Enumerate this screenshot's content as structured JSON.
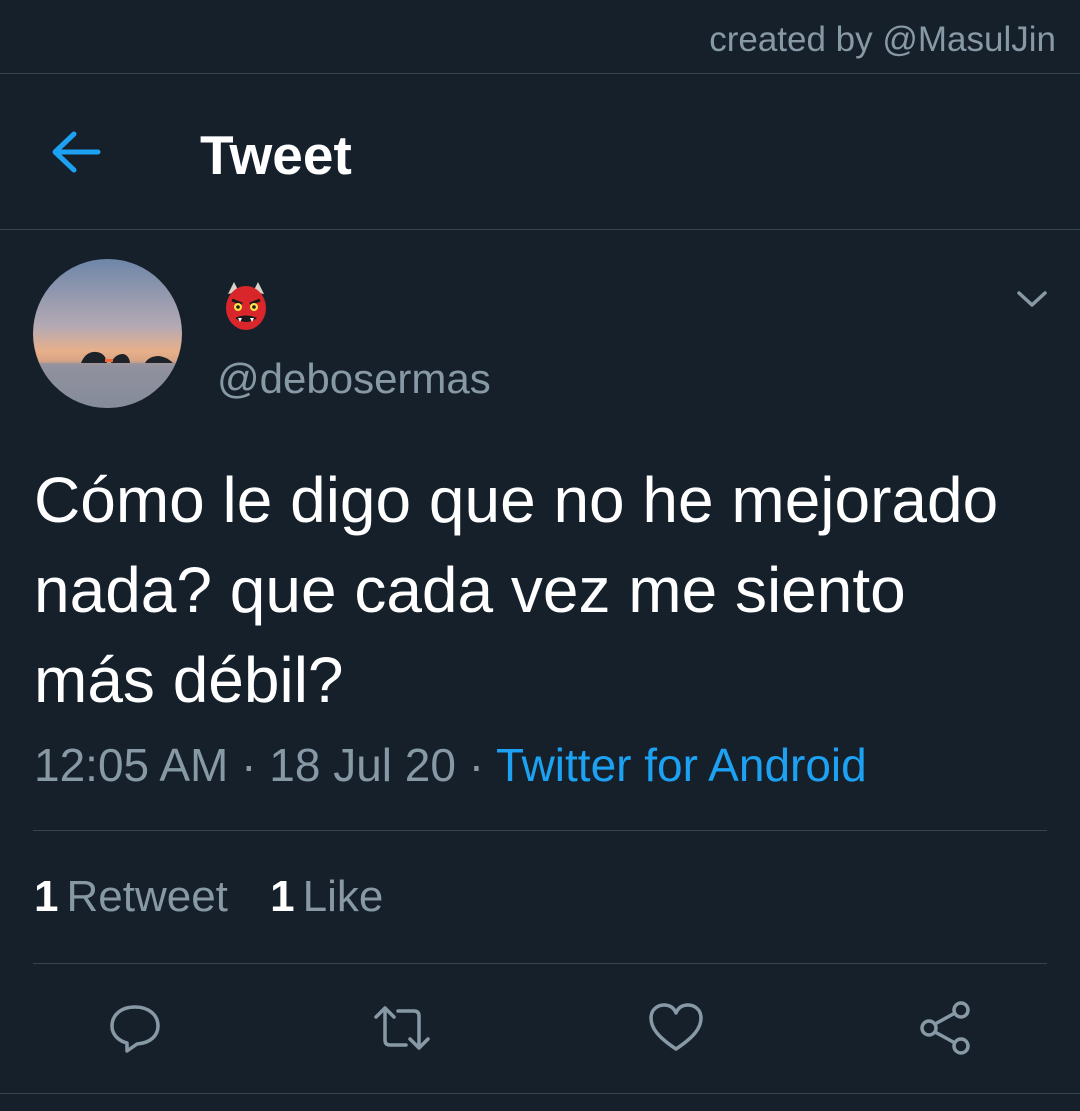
{
  "watermark": "created by @MasulJin",
  "header": {
    "title": "Tweet",
    "back_icon": "arrow-left-icon"
  },
  "tweet": {
    "display_name_icon": "red-oni-mask-emoji",
    "handle": "@debosermas",
    "text": "Cómo le digo que no he mejorado nada? que cada vez me siento más débil?",
    "time": "12:05 AM",
    "separator": "·",
    "date": "18 Jul 20",
    "source": "Twitter for Android"
  },
  "stats": {
    "retweets_count": "1",
    "retweets_label": "Retweet",
    "likes_count": "1",
    "likes_label": "Like"
  },
  "actions": [
    "reply-icon",
    "retweet-icon",
    "like-icon",
    "share-icon"
  ],
  "colors": {
    "background": "#15202b",
    "accent": "#1da1f2",
    "secondary_text": "#8899a6",
    "border": "#38444d"
  }
}
